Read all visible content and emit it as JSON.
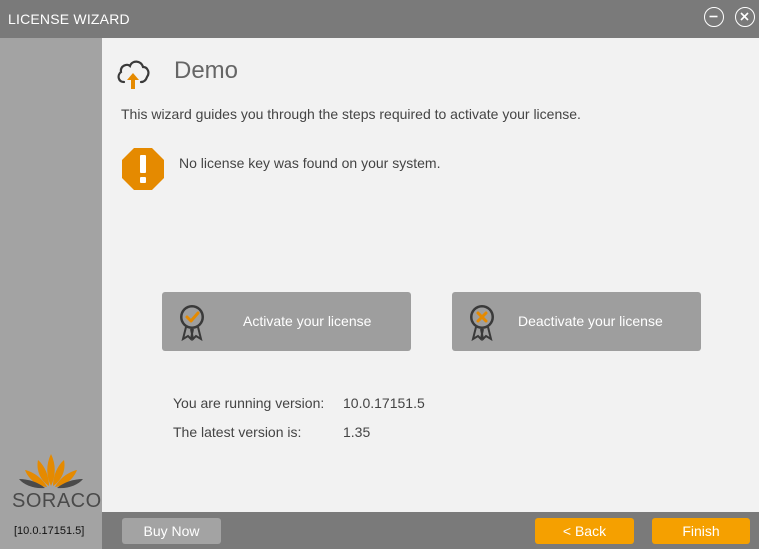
{
  "window": {
    "title": "LICENSE WIZARD"
  },
  "header": {
    "title": "Demo"
  },
  "intro": "This wizard guides you through the steps required to activate your license.",
  "warning": {
    "icon": "warning-octagon-icon",
    "message": "No license key was found on your system."
  },
  "actions": {
    "activate_label": "Activate your license",
    "deactivate_label": "Deactivate your license"
  },
  "version_info": {
    "running_label": "You are running version:",
    "running_value": "10.0.17151.5",
    "latest_label": "The latest version is:",
    "latest_value": "1.35"
  },
  "sidebar": {
    "brand": "SORACO",
    "version_badge": "[10.0.17151.5]"
  },
  "footer": {
    "buy_label": "Buy Now",
    "back_label": "< Back",
    "finish_label": "Finish"
  },
  "colors": {
    "accent": "#f5a000",
    "icon_orange": "#e58a00",
    "button_gray": "#9e9e9e"
  }
}
